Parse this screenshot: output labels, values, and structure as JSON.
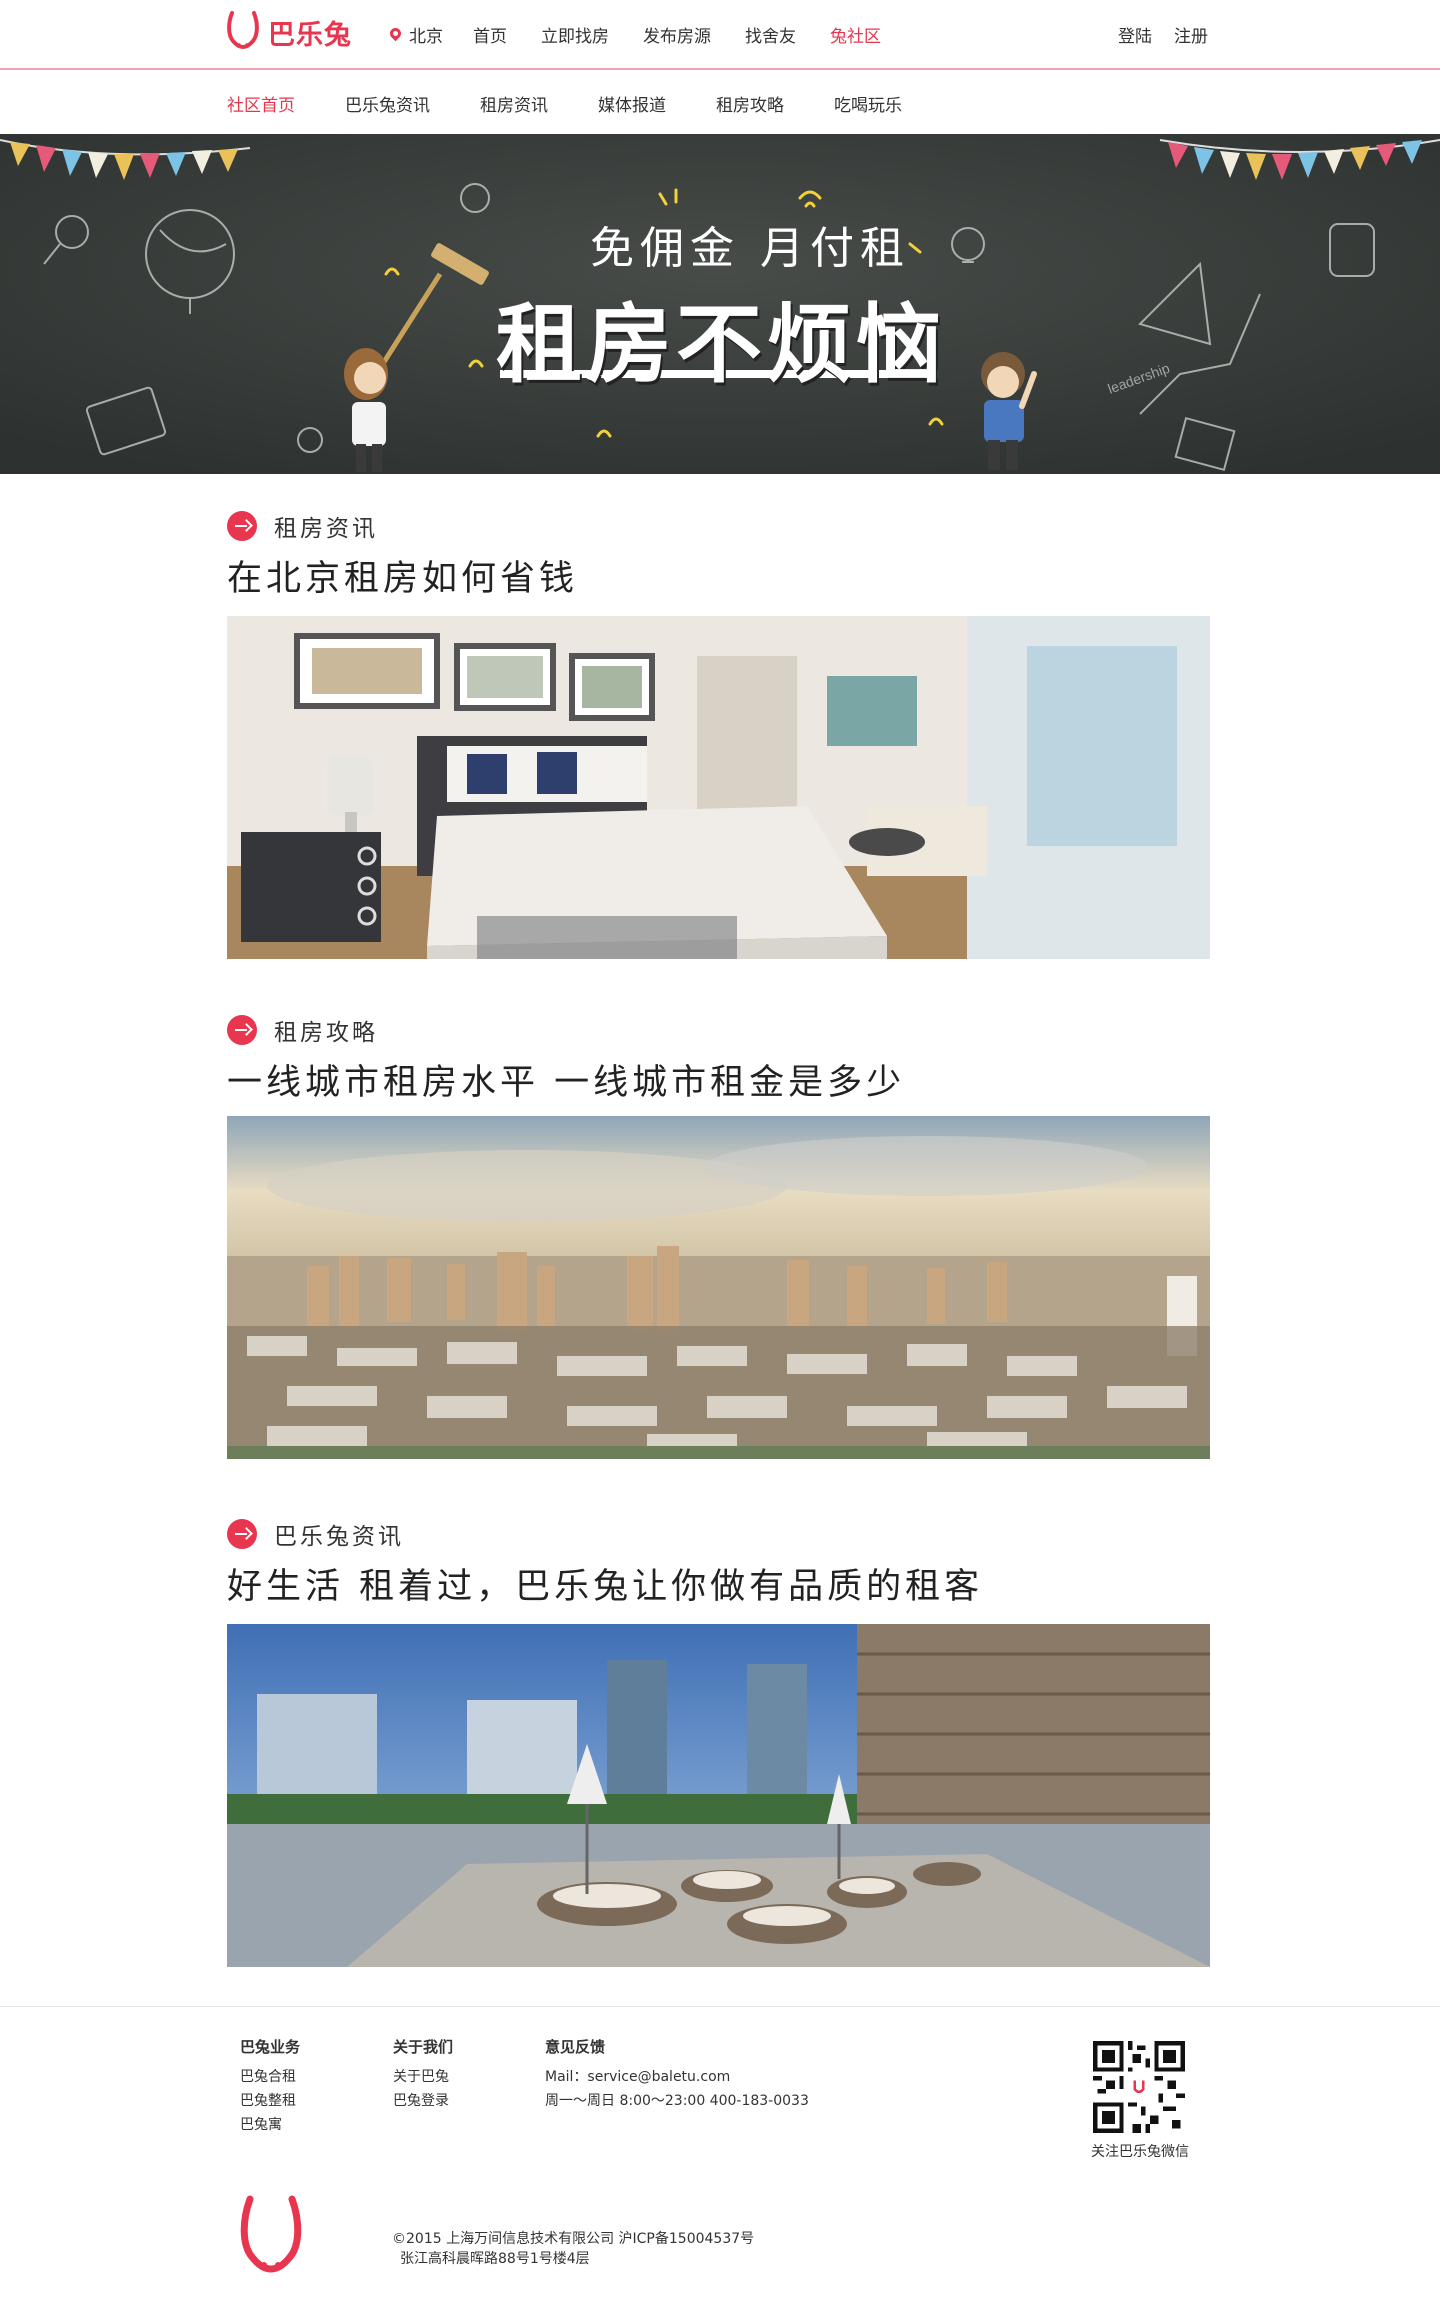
{
  "header": {
    "logo_text": "巴乐兔",
    "city": "北京",
    "nav": [
      {
        "label": "首页",
        "active": false
      },
      {
        "label": "立即找房",
        "active": false
      },
      {
        "label": "发布房源",
        "active": false
      },
      {
        "label": "找舍友",
        "active": false
      },
      {
        "label": "兔社区",
        "active": true
      }
    ],
    "login": "登陆",
    "register": "注册"
  },
  "subnav": [
    {
      "label": "社区首页",
      "active": true
    },
    {
      "label": "巴乐兔资讯",
      "active": false
    },
    {
      "label": "租房资讯",
      "active": false
    },
    {
      "label": "媒体报道",
      "active": false
    },
    {
      "label": "租房攻略",
      "active": false
    },
    {
      "label": "吃喝玩乐",
      "active": false
    }
  ],
  "banner": {
    "line1": "免佣金 月付租",
    "line2": "租房不烦恼",
    "chalk_text": "leadership"
  },
  "articles": [
    {
      "category": "租房资讯",
      "title": "在北京租房如何省钱",
      "image": "bedroom-photo"
    },
    {
      "category": "租房攻略",
      "title": "一线城市租房水平 一线城市租金是多少",
      "image": "city-skyline-photo"
    },
    {
      "category": "巴乐兔资讯",
      "title": "好生活 租着过，巴乐兔让你做有品质的租客",
      "image": "terrace-photo"
    }
  ],
  "footer": {
    "col1": {
      "heading": "巴兔业务",
      "items": [
        "巴兔合租",
        "巴兔整租",
        "巴兔寓"
      ]
    },
    "col2": {
      "heading": "关于我们",
      "items": [
        "关于巴兔",
        "巴兔登录"
      ]
    },
    "col3": {
      "heading": "意见反馈",
      "mail": "Mail：service@baletu.com",
      "hours": "周一～周日 8:00～23:00 400-183-0033"
    },
    "qr_label": "关注巴乐兔微信",
    "copyright_line1": "©2015 上海万间信息技术有限公司    沪ICP备15004537号",
    "copyright_line2": "张江高科晨晖路88号1号楼4层"
  },
  "colors": {
    "brand": "#e8364f",
    "chalkboard": "#3a3f3c"
  }
}
